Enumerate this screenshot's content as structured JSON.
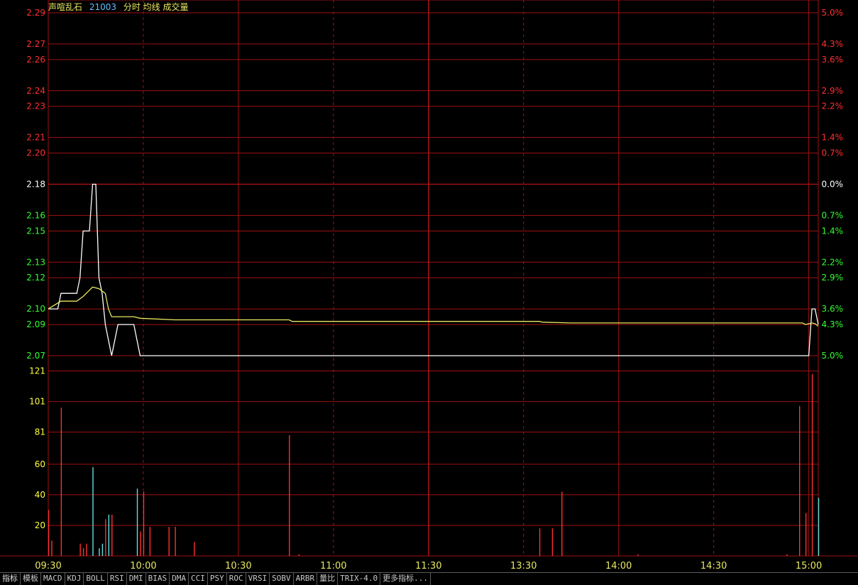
{
  "header": {
    "name": "声喧乱石",
    "code": "21003",
    "indicators": "分时 均线 成交量"
  },
  "tabs": [
    "指标",
    "模板",
    "MACD",
    "KDJ",
    "BOLL",
    "RSI",
    "DMI",
    "BIAS",
    "DMA",
    "CCI",
    "PSY",
    "ROC",
    "VRSI",
    "SOBV",
    "ARBR",
    "量比",
    "TRIX-4.0",
    "更多指标..."
  ],
  "colors": {
    "grid": "#a01010",
    "price_line": "#ffffff",
    "avg_line": "#e8e860",
    "up": "#ff3030",
    "down": "#30ff30",
    "neutral": "#ffffff",
    "vol_label": "#ffff40",
    "vol_down": "#60e0e0"
  },
  "chart_data": [
    {
      "type": "line",
      "panel": "price",
      "prev_close": 2.18,
      "ylim": [
        2.07,
        2.29
      ],
      "left_ticks": [
        {
          "label": "2.29",
          "value": 2.29,
          "side": "up"
        },
        {
          "label": "2.27",
          "value": 2.27,
          "side": "up"
        },
        {
          "label": "2.26",
          "value": 2.26,
          "side": "up"
        },
        {
          "label": "2.24",
          "value": 2.24,
          "side": "up"
        },
        {
          "label": "2.23",
          "value": 2.23,
          "side": "up"
        },
        {
          "label": "2.21",
          "value": 2.21,
          "side": "up"
        },
        {
          "label": "2.20",
          "value": 2.2,
          "side": "up"
        },
        {
          "label": "2.18",
          "value": 2.18,
          "side": "flat"
        },
        {
          "label": "2.16",
          "value": 2.16,
          "side": "down"
        },
        {
          "label": "2.15",
          "value": 2.15,
          "side": "down"
        },
        {
          "label": "2.13",
          "value": 2.13,
          "side": "down"
        },
        {
          "label": "2.12",
          "value": 2.12,
          "side": "down"
        },
        {
          "label": "2.10",
          "value": 2.1,
          "side": "down"
        },
        {
          "label": "2.09",
          "value": 2.09,
          "side": "down"
        },
        {
          "label": "2.07",
          "value": 2.07,
          "side": "down"
        }
      ],
      "right_ticks": [
        "5.0%",
        "4.3%",
        "3.6%",
        "2.9%",
        "2.2%",
        "1.4%",
        "0.7%",
        "0.0%",
        "0.7%",
        "1.4%",
        "2.2%",
        "2.9%",
        "3.6%",
        "4.3%",
        "5.0%"
      ],
      "x_labels": [
        "09:30",
        "10:00",
        "10:30",
        "11:00",
        "11:30",
        "13:30",
        "14:00",
        "14:30",
        "15:00"
      ],
      "series": [
        {
          "key": "price",
          "points": [
            [
              0,
              2.1
            ],
            [
              3,
              2.1
            ],
            [
              4,
              2.11
            ],
            [
              9,
              2.11
            ],
            [
              10,
              2.12
            ],
            [
              11,
              2.15
            ],
            [
              13,
              2.15
            ],
            [
              14,
              2.18
            ],
            [
              15,
              2.18
            ],
            [
              16,
              2.12
            ],
            [
              17,
              2.11
            ],
            [
              18,
              2.09
            ],
            [
              19,
              2.08
            ],
            [
              20,
              2.07
            ],
            [
              21,
              2.08
            ],
            [
              22,
              2.09
            ],
            [
              27,
              2.09
            ],
            [
              28,
              2.08
            ],
            [
              29,
              2.07
            ],
            [
              240,
              2.07
            ],
            [
              241,
              2.1
            ],
            [
              242,
              2.1
            ],
            [
              243,
              2.09
            ]
          ]
        },
        {
          "key": "avg",
          "points": [
            [
              0,
              2.1
            ],
            [
              4,
              2.105
            ],
            [
              9,
              2.105
            ],
            [
              11,
              2.108
            ],
            [
              13,
              2.112
            ],
            [
              14,
              2.114
            ],
            [
              16,
              2.113
            ],
            [
              18,
              2.11
            ],
            [
              19,
              2.1
            ],
            [
              20,
              2.095
            ],
            [
              27,
              2.095
            ],
            [
              29,
              2.094
            ],
            [
              40,
              2.093
            ],
            [
              76,
              2.093
            ],
            [
              77,
              2.092
            ],
            [
              155,
              2.092
            ],
            [
              156,
              2.0915
            ],
            [
              165,
              2.091
            ],
            [
              238,
              2.091
            ],
            [
              239,
              2.09
            ],
            [
              241,
              2.091
            ],
            [
              242,
              2.0905
            ],
            [
              243,
              2.089
            ]
          ]
        }
      ]
    },
    {
      "type": "bar",
      "panel": "volume",
      "ylim": [
        0,
        131
      ],
      "ticks": [
        20,
        40,
        60,
        81,
        101,
        121
      ],
      "tick_labels": [
        "20",
        "40",
        "60",
        "81",
        "101",
        "121"
      ],
      "bars": [
        {
          "t": 0,
          "v": 30,
          "dir": "up"
        },
        {
          "t": 1,
          "v": 10,
          "dir": "up"
        },
        {
          "t": 4,
          "v": 97,
          "dir": "up"
        },
        {
          "t": 10,
          "v": 8,
          "dir": "up"
        },
        {
          "t": 11,
          "v": 5,
          "dir": "up"
        },
        {
          "t": 12,
          "v": 8,
          "dir": "up"
        },
        {
          "t": 14,
          "v": 58,
          "dir": "down"
        },
        {
          "t": 16,
          "v": 5,
          "dir": "down"
        },
        {
          "t": 17,
          "v": 8,
          "dir": "down"
        },
        {
          "t": 18,
          "v": 24,
          "dir": "up"
        },
        {
          "t": 19,
          "v": 27,
          "dir": "down"
        },
        {
          "t": 20,
          "v": 27,
          "dir": "up"
        },
        {
          "t": 28,
          "v": 44,
          "dir": "down"
        },
        {
          "t": 29,
          "v": 16,
          "dir": "up"
        },
        {
          "t": 30,
          "v": 42,
          "dir": "up"
        },
        {
          "t": 32,
          "v": 19,
          "dir": "up"
        },
        {
          "t": 38,
          "v": 19,
          "dir": "up"
        },
        {
          "t": 40,
          "v": 19,
          "dir": "up"
        },
        {
          "t": 46,
          "v": 9,
          "dir": "up"
        },
        {
          "t": 76,
          "v": 79,
          "dir": "up"
        },
        {
          "t": 79,
          "v": 1,
          "dir": "up"
        },
        {
          "t": 155,
          "v": 18,
          "dir": "up"
        },
        {
          "t": 159,
          "v": 18,
          "dir": "up"
        },
        {
          "t": 162,
          "v": 42,
          "dir": "up"
        },
        {
          "t": 186,
          "v": 1,
          "dir": "up"
        },
        {
          "t": 233,
          "v": 1,
          "dir": "up"
        },
        {
          "t": 237,
          "v": 98,
          "dir": "up"
        },
        {
          "t": 239,
          "v": 28,
          "dir": "up"
        },
        {
          "t": 241,
          "v": 119,
          "dir": "up"
        },
        {
          "t": 243,
          "v": 38,
          "dir": "down"
        }
      ]
    }
  ]
}
